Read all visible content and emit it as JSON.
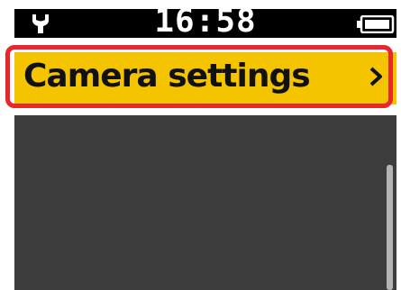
{
  "status_bar": {
    "time": "16:58",
    "left_icon": "wrench-icon",
    "right_icon": "battery-icon"
  },
  "menu": {
    "selected_item": {
      "label": "Camera settings",
      "icon": "chevron-right-icon"
    }
  },
  "colors": {
    "status_bar_bg": "#000000",
    "highlight_bg": "#f5c400",
    "focus_border": "#e8262d",
    "panel_bg": "#3d3d3d",
    "scrollbar": "#b4b4b4"
  }
}
